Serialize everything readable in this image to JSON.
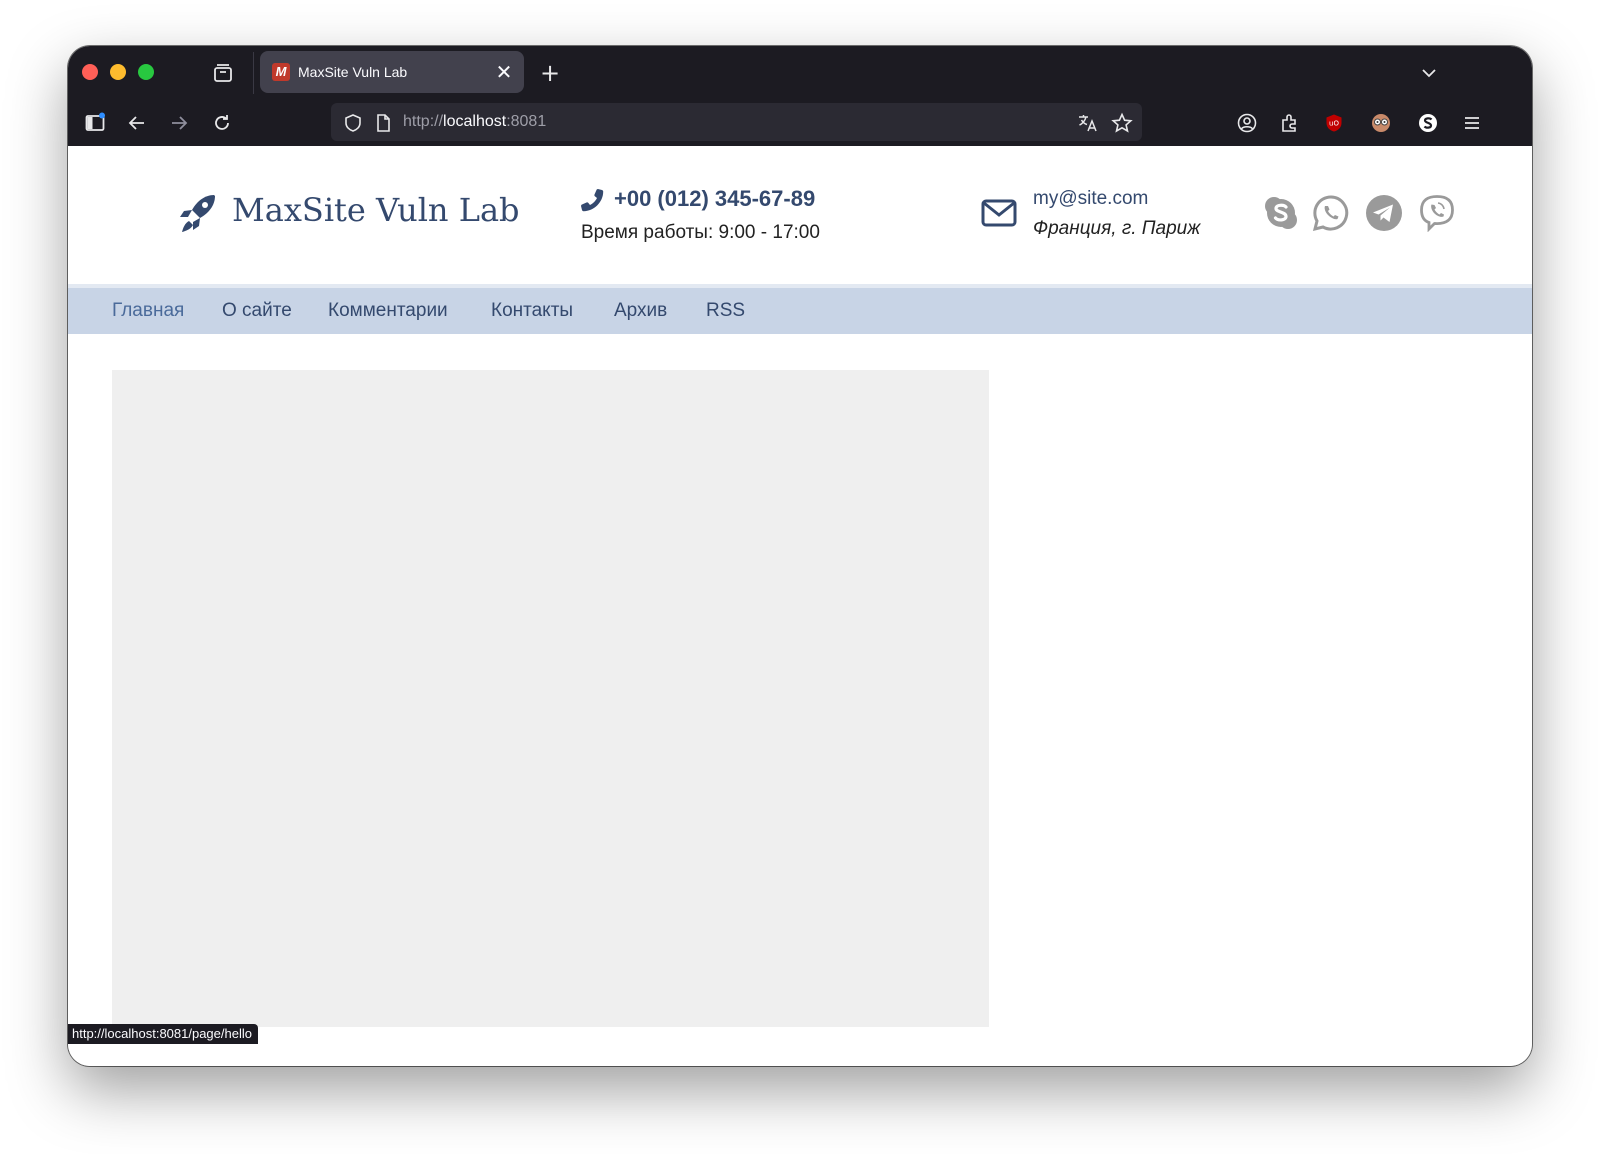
{
  "browser": {
    "tab_title": "MaxSite Vuln Lab",
    "favicon_letter": "M",
    "url_scheme": "http://",
    "url_host": "localhost",
    "url_port": ":8081",
    "status_url": "http://localhost:8081/page/hello",
    "new_tab_symbol": "+",
    "close_symbol": "✕"
  },
  "site": {
    "title": "MaxSite Vuln Lab",
    "phone": "+00 (012) 345-67-89",
    "hours": "Время работы: 9:00 - 17:00",
    "email": "my@site.com",
    "location": "Франция, г. Париж"
  },
  "menu": {
    "items": [
      "Главная",
      "О сайте",
      "Комментарии",
      "Контакты",
      "Архив",
      "RSS"
    ]
  },
  "colors": {
    "brand": "#34496e",
    "menu_bar": "#c8d4e6",
    "placeholder": "#efefef",
    "social_icon": "#9a9a9a",
    "browser_chrome": "#1c1b22"
  },
  "icons": {
    "logo": "rocket-icon",
    "phone": "phone-icon",
    "mail": "mail-icon",
    "social": [
      "skype-icon",
      "whatsapp-icon",
      "telegram-icon",
      "viber-icon"
    ]
  }
}
